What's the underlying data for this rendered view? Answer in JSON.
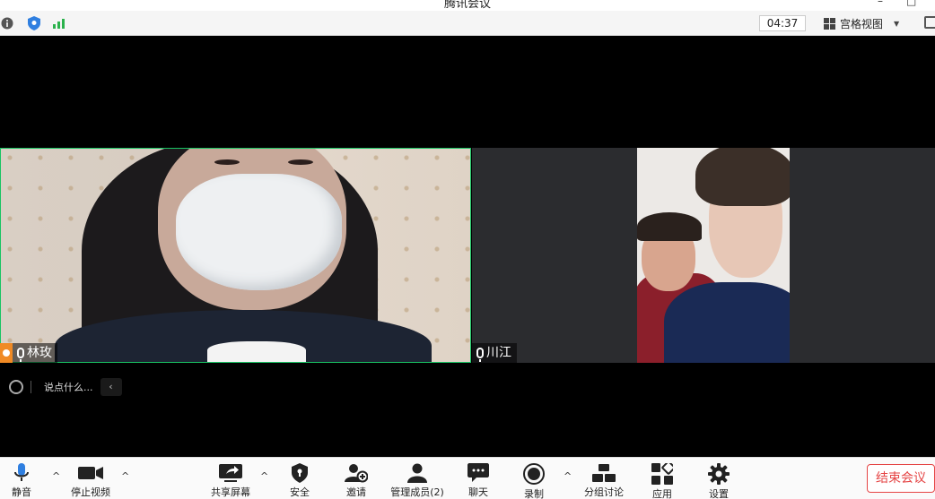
{
  "window": {
    "title": "腾讯会议",
    "minimize": "–",
    "maximize": "□"
  },
  "infobar": {
    "timer": "04:37",
    "view_label": "宫格视图",
    "icons": {
      "info": "info-icon",
      "security": "shield-icon",
      "signal": "signal-icon",
      "grid": "grid-icon",
      "fullscreen": "fullscreen-icon"
    }
  },
  "participants": [
    {
      "name": "林玫",
      "host": true,
      "mic": "microphone-icon"
    },
    {
      "name": "川江",
      "host": false,
      "mic": "microphone-icon"
    }
  ],
  "chat": {
    "placeholder": "说点什么...",
    "collapse": "‹"
  },
  "toolbar": {
    "mute": "静音",
    "stop_video": "停止视频",
    "share_screen": "共享屏幕",
    "security": "安全",
    "invite": "邀请",
    "manage_members": "管理成员(2)",
    "chat": "聊天",
    "record": "录制",
    "breakout": "分组讨论",
    "apps": "应用",
    "settings": "设置",
    "end_meeting": "结束会议",
    "caret": "^"
  },
  "colors": {
    "active_speaker_border": "#19c463",
    "end_button": "#e54545",
    "host_badge": "#f08a24",
    "shield": "#2f7fe0",
    "signal": "#2bb24c"
  }
}
